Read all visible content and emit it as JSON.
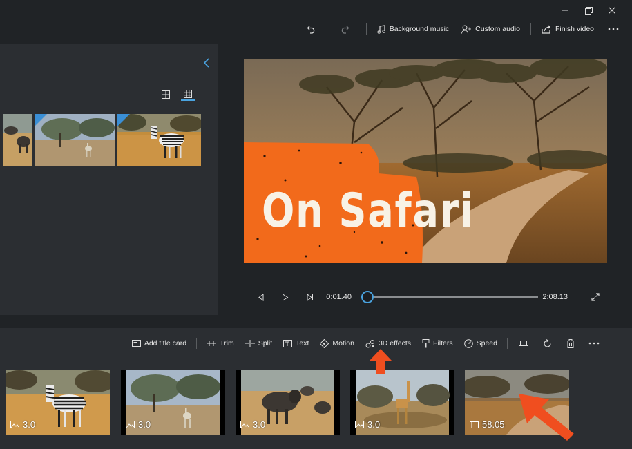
{
  "window_controls": {
    "minimize_icon": "minimize-icon",
    "restore_icon": "restore-icon",
    "close_icon": "close-icon"
  },
  "top_toolbar": {
    "undo_icon": "undo-icon",
    "redo_icon": "redo-icon",
    "background_music": "Background music",
    "custom_audio": "Custom audio",
    "finish_video": "Finish video",
    "more_icon": "more-icon"
  },
  "library": {
    "collapse_icon": "chevron-left-icon",
    "view_options": [
      "large-grid-icon",
      "small-grid-icon"
    ],
    "active_view": "small-grid-icon",
    "thumbnails": [
      "wildebeest",
      "gazelle",
      "zebra"
    ]
  },
  "preview": {
    "title_text": "On Safari",
    "accent_color": "#f26a1b"
  },
  "playback": {
    "current_time": "0:01.40",
    "total_time": "2:08.13",
    "progress": 0.011
  },
  "storyboard_toolbar": {
    "add_title_card": "Add title card",
    "trim": "Trim",
    "split": "Split",
    "text": "Text",
    "motion": "Motion",
    "effects_3d": "3D effects",
    "filters": "Filters",
    "speed": "Speed"
  },
  "clips": [
    {
      "label": "3.0",
      "kind": "image-icon",
      "scene": "zebra"
    },
    {
      "label": "3.0",
      "kind": "image-icon",
      "scene": "gazelle"
    },
    {
      "label": "3.0",
      "kind": "image-icon",
      "scene": "wildebeest"
    },
    {
      "label": "3.0",
      "kind": "image-icon",
      "scene": "giraffe"
    },
    {
      "label": "58.05",
      "kind": "video-icon",
      "scene": "safari-road"
    }
  ],
  "colors": {
    "accent_blue": "#4aa3df",
    "callout_orange": "#f04e1f"
  }
}
